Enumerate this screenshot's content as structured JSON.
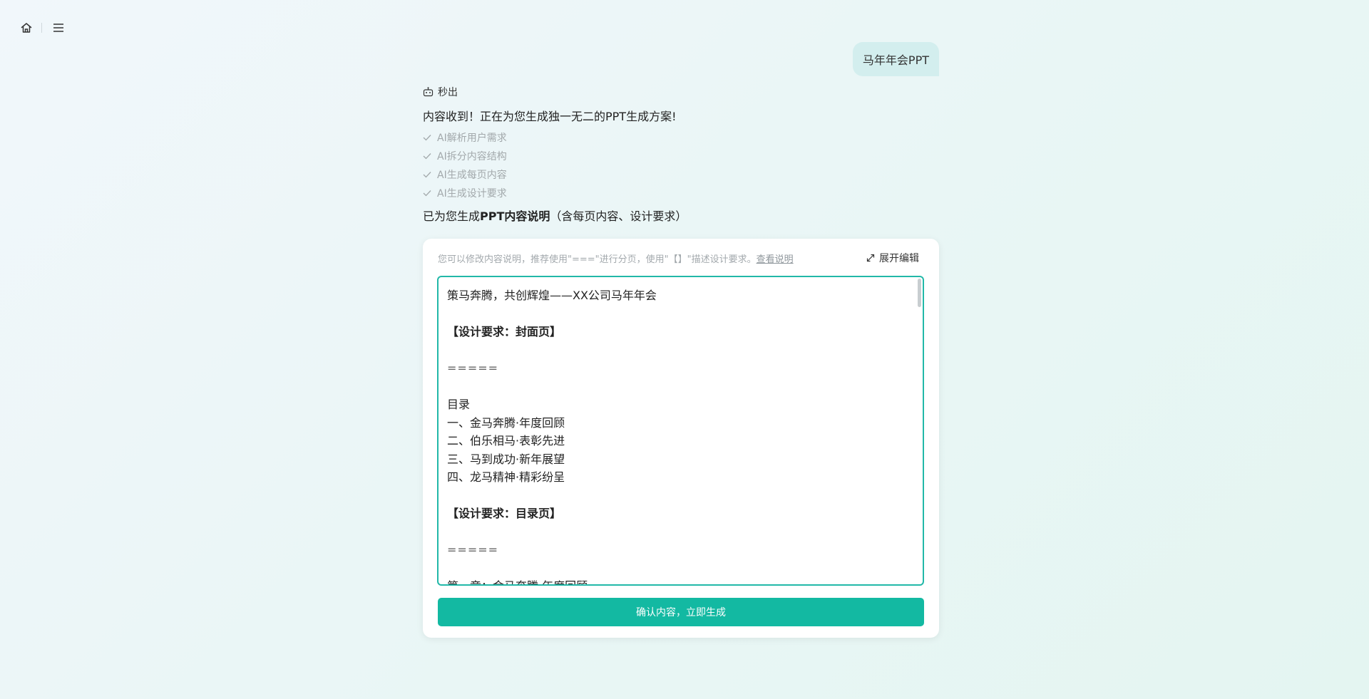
{
  "topbar": {
    "home_icon": "home-icon",
    "menu_icon": "menu-icon"
  },
  "user_message": "马年年会PPT",
  "assistant": {
    "sender_name": "秒出",
    "intro": "内容收到！正在为您生成独一无二的PPT生成方案!",
    "steps": [
      {
        "label": "AI解析用户需求",
        "icon": "check-icon"
      },
      {
        "label": "AI拆分内容结构",
        "icon": "check-icon"
      },
      {
        "label": "AI生成每页内容",
        "icon": "check-icon"
      },
      {
        "label": "AI生成设计要求",
        "icon": "check-icon"
      }
    ],
    "summary_prefix": "已为您生成",
    "summary_bold": "PPT内容说明",
    "summary_suffix": "（含每页内容、设计要求）"
  },
  "card": {
    "hint": "您可以修改内容说明，推荐使用\"===\"进行分页，使用\"【】\"描述设计要求。",
    "hint_link": "查看说明",
    "expand_label": "展开编辑",
    "editor_lines": [
      {
        "text": "策马奔腾，共创辉煌——XX公司马年年会",
        "style": "normal"
      },
      {
        "text": "",
        "style": "normal"
      },
      {
        "text": "【设计要求：封面页】",
        "style": "bold"
      },
      {
        "text": "",
        "style": "normal"
      },
      {
        "text": "=====",
        "style": "sep"
      },
      {
        "text": "",
        "style": "normal"
      },
      {
        "text": "目录",
        "style": "normal"
      },
      {
        "text": "一、金马奔腾·年度回顾",
        "style": "normal"
      },
      {
        "text": "二、伯乐相马·表彰先进",
        "style": "normal"
      },
      {
        "text": "三、马到成功·新年展望",
        "style": "normal"
      },
      {
        "text": "四、龙马精神·精彩纷呈",
        "style": "normal"
      },
      {
        "text": "",
        "style": "normal"
      },
      {
        "text": "【设计要求：目录页】",
        "style": "bold"
      },
      {
        "text": "",
        "style": "normal"
      },
      {
        "text": "=====",
        "style": "sep"
      },
      {
        "text": "",
        "style": "normal"
      },
      {
        "text": "第一章：金马奔腾·年度回顾",
        "style": "normal"
      }
    ],
    "confirm_label": "确认内容，立即生成"
  },
  "colors": {
    "accent": "#13b9a2",
    "editor_border": "#22b8a8",
    "user_bubble": "#d3eeee"
  }
}
